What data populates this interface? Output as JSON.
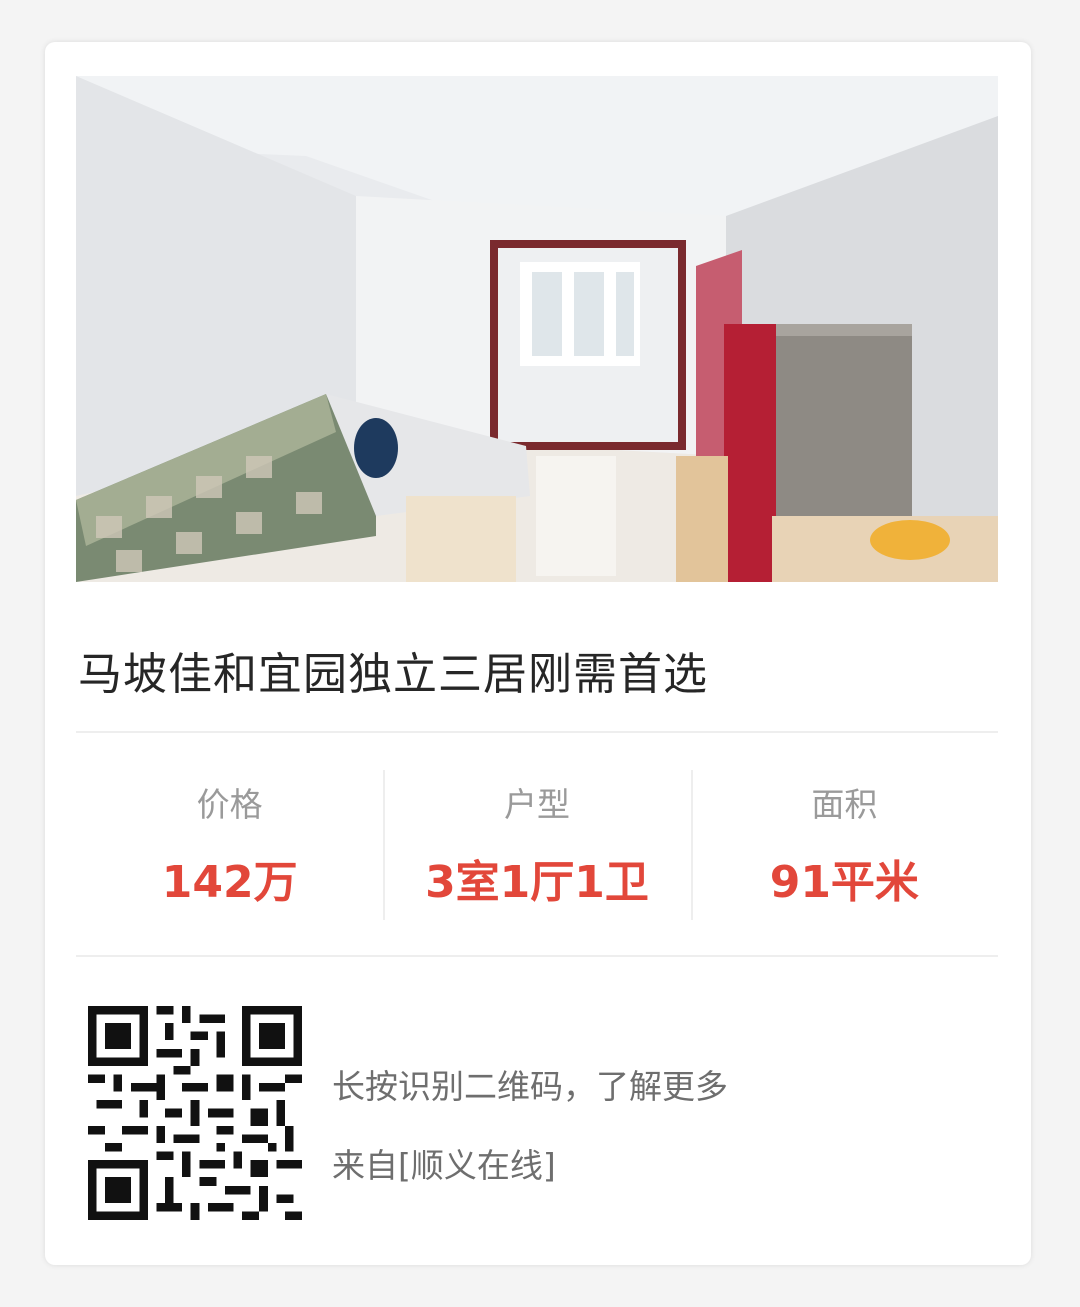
{
  "listing": {
    "title": "马坡佳和宜园独立三居刚需首选",
    "photo_icon": "apartment-living-room-photo"
  },
  "stats": [
    {
      "label": "价格",
      "value": "142万"
    },
    {
      "label": "户型",
      "value": "3室1厅1卫"
    },
    {
      "label": "面积",
      "value": "91平米"
    }
  ],
  "footer": {
    "qr_icon": "qr-code-icon",
    "scan_hint": "长按识别二维码，了解更多",
    "source": "来自[顺义在线]"
  },
  "colors": {
    "accent": "#e2473a",
    "title": "#262626",
    "label": "#9a9a9a",
    "muted": "#6e6e6e"
  }
}
